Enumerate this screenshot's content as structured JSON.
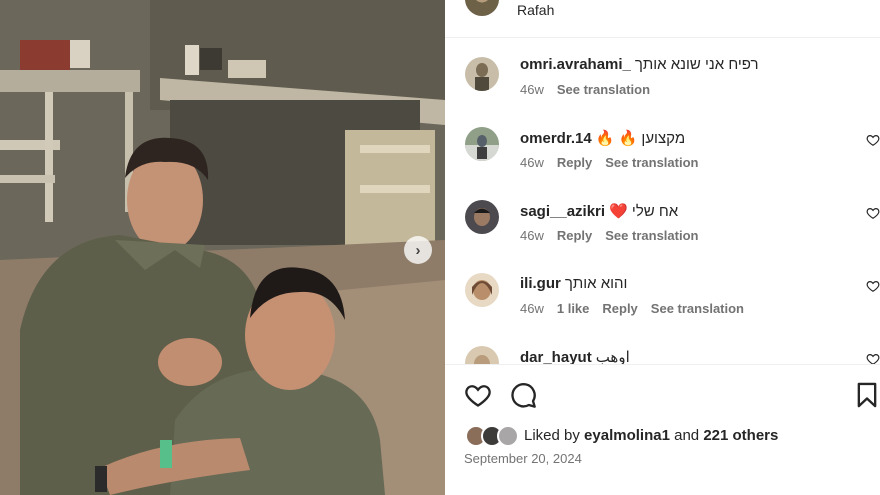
{
  "post": {
    "location": "Rafah",
    "carousel_next": "›"
  },
  "comments": [
    {
      "username": "omri.avrahami_",
      "text": "רפיח אני שונא אותך",
      "age": "46w",
      "likes": "",
      "reply": "",
      "translation": "See translation",
      "avatar_color": "#7a6c55",
      "has_heart": false
    },
    {
      "username": "omerdr.14",
      "text": "🔥 🔥 מקצוען",
      "age": "46w",
      "likes": "",
      "reply": "Reply",
      "translation": "See translation",
      "avatar_color": "#55606a",
      "has_heart": true
    },
    {
      "username": "sagi__azikri",
      "text": "❤️ אח שלי",
      "age": "46w",
      "likes": "",
      "reply": "Reply",
      "translation": "See translation",
      "avatar_color": "#4c4a4e",
      "has_heart": true
    },
    {
      "username": "ili.gur",
      "text": "והוא אותך",
      "age": "46w",
      "likes": "1 like",
      "reply": "Reply",
      "translation": "See translation",
      "avatar_color": "#b88f6a",
      "has_heart": true
    },
    {
      "username": "dar_hayut",
      "text": "اوهب",
      "age": "",
      "likes": "",
      "reply": "",
      "translation": "",
      "avatar_color": "#d9c9b0",
      "has_heart": true
    }
  ],
  "likes": {
    "prefix": "Liked by ",
    "user": "eyalmolina1",
    "middle": " and ",
    "others": "221 others",
    "avatar_colors": [
      "#8a6e5a",
      "#3d3a3a",
      "#a9a6a8"
    ]
  },
  "date": "September 20, 2024",
  "icons": {
    "like": "heart-icon",
    "comment": "comment-icon",
    "save": "bookmark-icon",
    "comment_like": "heart-small-icon"
  }
}
